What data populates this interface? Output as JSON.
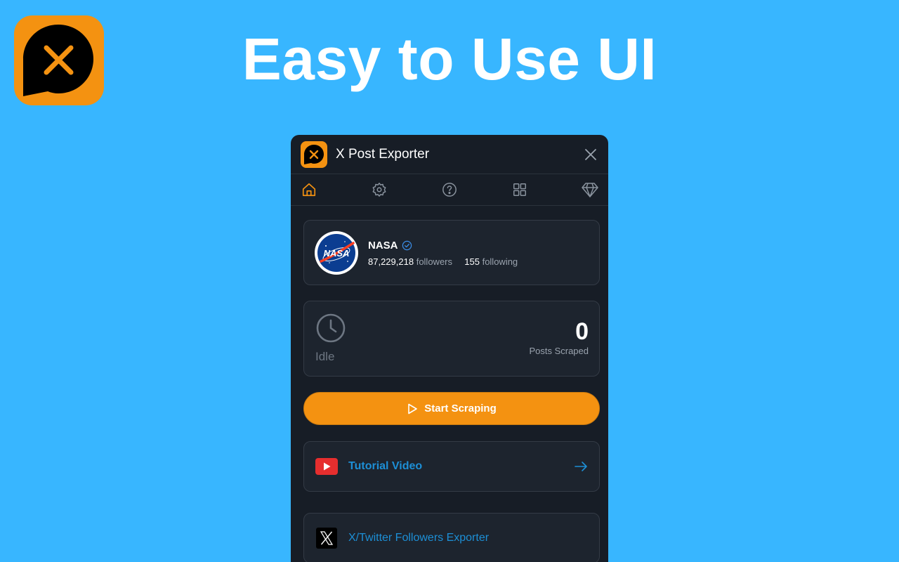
{
  "headline": "Easy to Use UI",
  "colors": {
    "background": "#38b6ff",
    "accent": "#f49211",
    "panel": "#171d26",
    "link": "#1d8fd6"
  },
  "panel": {
    "title": "X Post Exporter",
    "tabs": [
      "home-icon",
      "settings-icon",
      "help-icon",
      "apps-grid-icon",
      "premium-diamond-icon"
    ],
    "active_tab": "home-icon"
  },
  "profile": {
    "name": "NASA",
    "verified": true,
    "followers_count": "87,229,218",
    "followers_label": "followers",
    "following_count": "155",
    "following_label": "following"
  },
  "status": {
    "state": "Idle",
    "count": "0",
    "count_label": "Posts Scraped"
  },
  "actions": {
    "start_label": "Start Scraping"
  },
  "links": {
    "tutorial": "Tutorial Video",
    "followers_exporter": "X/Twitter Followers Exporter"
  }
}
